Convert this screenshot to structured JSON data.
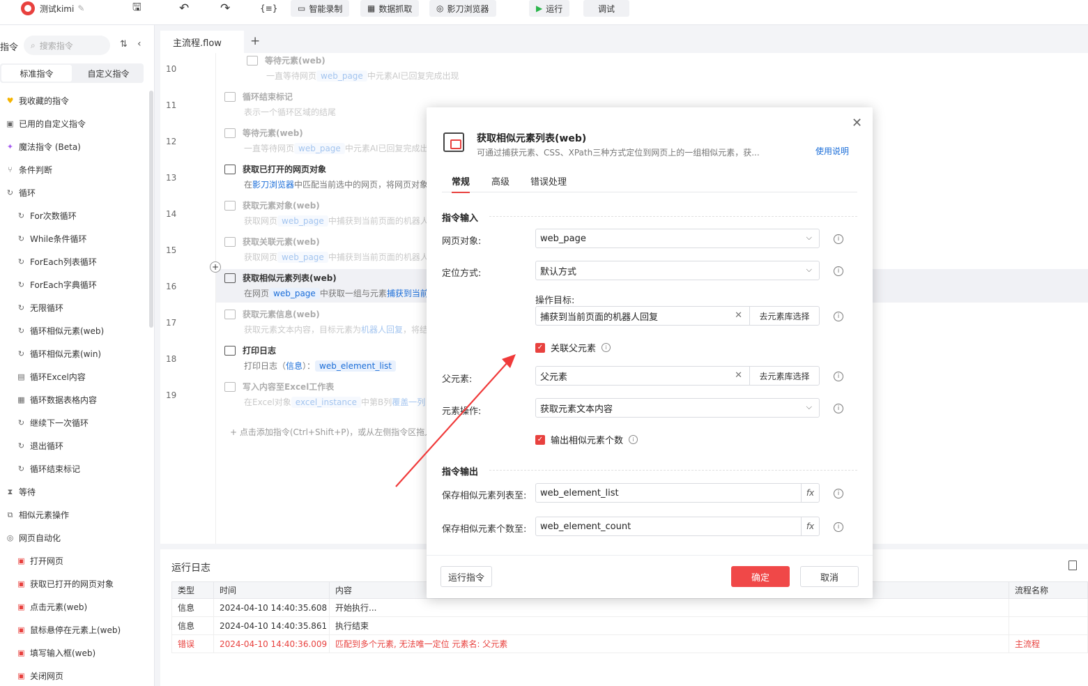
{
  "app": {
    "title": "测试kimi"
  },
  "toolbar": {
    "buttons": [
      "{≡}",
      "智能录制",
      "数据抓取",
      "影刀浏览器",
      "运行",
      "调试"
    ]
  },
  "sidebar": {
    "header": "指令",
    "search_placeholder": "搜索指令",
    "tabs": [
      "标准指令",
      "自定义指令"
    ],
    "items": [
      {
        "label": "我收藏的指令",
        "icon": "heart-icon"
      },
      {
        "label": "已用的自定义指令",
        "icon": "box-icon"
      },
      {
        "label": "魔法指令 (Beta)",
        "icon": "sparkle-icon"
      },
      {
        "label": "条件判断",
        "icon": "branch-icon"
      },
      {
        "label": "循环",
        "icon": "loop-icon"
      },
      {
        "label": "For次数循环",
        "icon": "loop-icon",
        "sub": true
      },
      {
        "label": "While条件循环",
        "icon": "loop-icon",
        "sub": true
      },
      {
        "label": "ForEach列表循环",
        "icon": "loop-icon",
        "sub": true
      },
      {
        "label": "ForEach字典循环",
        "icon": "loop-icon",
        "sub": true
      },
      {
        "label": "无限循环",
        "icon": "loop-icon",
        "sub": true
      },
      {
        "label": "循环相似元素(web)",
        "icon": "loop-icon",
        "sub": true
      },
      {
        "label": "循环相似元素(win)",
        "icon": "loop-icon",
        "sub": true
      },
      {
        "label": "循环Excel内容",
        "icon": "excel-icon",
        "sub": true
      },
      {
        "label": "循环数据表格内容",
        "icon": "table-icon",
        "sub": true
      },
      {
        "label": "继续下一次循环",
        "icon": "loop-icon",
        "sub": true
      },
      {
        "label": "退出循环",
        "icon": "loop-icon",
        "sub": true
      },
      {
        "label": "循环结束标记",
        "icon": "loop-icon",
        "sub": true
      },
      {
        "label": "等待",
        "icon": "hourglass-icon"
      },
      {
        "label": "相似元素操作",
        "icon": "copy-icon"
      },
      {
        "label": "网页自动化",
        "icon": "globe-icon"
      },
      {
        "label": "打开网页",
        "icon": "web-icon",
        "sub": true
      },
      {
        "label": "获取已打开的网页对象",
        "icon": "web-icon",
        "sub": true
      },
      {
        "label": "点击元素(web)",
        "icon": "web-icon",
        "sub": true
      },
      {
        "label": "鼠标悬停在元素上(web)",
        "icon": "web-icon",
        "sub": true
      },
      {
        "label": "填写输入框(web)",
        "icon": "web-icon",
        "sub": true
      },
      {
        "label": "关闭网页",
        "icon": "web-icon",
        "sub": true
      }
    ]
  },
  "editor": {
    "tab": "主流程.flow",
    "add_tab": "+",
    "lines": [
      {
        "n": "10",
        "title": "等待元素(web)",
        "desc_parts": [
          "一直等待网页",
          "web_page",
          "中元素AI已回复完成出现"
        ],
        "dim": true
      },
      {
        "n": "11",
        "title": "循环结束标记",
        "desc_parts": [
          "表示一个循环区域的结尾"
        ],
        "dim": true
      },
      {
        "n": "12",
        "title": "等待元素(web)",
        "desc_parts": [
          "一直等待网页",
          "web_page",
          "中元素AI已回复完成出"
        ],
        "dim": true
      },
      {
        "n": "13",
        "title": "获取已打开的网页对象",
        "desc_parts": [
          "在",
          "影刀浏览器",
          "中匹配当前选中的网页，将网页对象"
        ],
        "dim": false
      },
      {
        "n": "14",
        "title": "获取元素对象(web)",
        "desc_parts": [
          "获取网页",
          "web_page",
          "中捕获到当前页面的机器人"
        ],
        "dim": true
      },
      {
        "n": "15",
        "title": "获取关联元素(web)",
        "desc_parts": [
          "获取网页",
          "web_page",
          "中捕获到当前页面的机器人"
        ],
        "dim": true
      },
      {
        "n": "16",
        "title": "获取相似元素列表(web)",
        "desc_parts": [
          "在网页",
          "web_page",
          "中获取一组与元素",
          "捕获到当前"
        ],
        "dim": false
      },
      {
        "n": "17",
        "title": "获取元素信息(web)",
        "desc_parts": [
          "获取元素文本内容，目标元素为",
          "机器人回复",
          "，将结"
        ],
        "dim": true
      },
      {
        "n": "18",
        "title": "打印日志",
        "desc_parts": [
          "打印日志（",
          "信息",
          "）：",
          "web_element_list"
        ],
        "dim": false
      },
      {
        "n": "19",
        "title": "写入内容至Excel工作表",
        "desc_parts": [
          "在Excel对象",
          "excel_instance",
          "中第B列",
          "覆盖一列"
        ],
        "dim": true
      }
    ],
    "add_hint": "点击添加指令(Ctrl+Shift+P)，或从左侧指令区拖入"
  },
  "log": {
    "title": "运行日志",
    "columns": [
      "类型",
      "时间",
      "内容",
      "流程名称"
    ],
    "rows": [
      {
        "type": "信息",
        "time": "2024-04-10 14:40:35.608",
        "content": "开始执行...",
        "flow": "",
        "err": false
      },
      {
        "type": "信息",
        "time": "2024-04-10 14:40:35.861",
        "content": "执行结束",
        "flow": "",
        "err": false
      },
      {
        "type": "错误",
        "time": "2024-04-10 14:40:36.009",
        "content": "匹配到多个元素, 无法唯一定位 元素名: 父元素",
        "flow": "主流程",
        "err": true
      }
    ]
  },
  "modal": {
    "title": "获取相似元素列表(web)",
    "desc": "可通过捕获元素、CSS、XPath三种方式定位到网页上的一组相似元素，获...",
    "help": "使用说明",
    "tabs": [
      "常规",
      "高级",
      "错误处理"
    ],
    "section_input": "指令输入",
    "section_output": "指令输出",
    "web_object_label": "网页对象:",
    "web_object_value": "web_page",
    "locate_label": "定位方式:",
    "locate_value": "默认方式",
    "target_label": "操作目标:",
    "target_value": "捕获到当前页面的机器人回复",
    "lib_button": "去元素库选择",
    "assoc_parent": "关联父元素",
    "parent_label": "父元素:",
    "parent_value": "父元素",
    "op_label": "元素操作:",
    "op_value": "获取元素文本内容",
    "output_count_chk": "输出相似元素个数",
    "save_list_label": "保存相似元素列表至:",
    "save_list_value": "web_element_list",
    "save_count_label": "保存相似元素个数至:",
    "save_count_value": "web_element_count",
    "fx": "fx",
    "run_button": "运行指令",
    "ok_button": "确定",
    "cancel_button": "取消"
  },
  "colors": {
    "accent": "#e8413e",
    "link": "#1a6dd8"
  }
}
